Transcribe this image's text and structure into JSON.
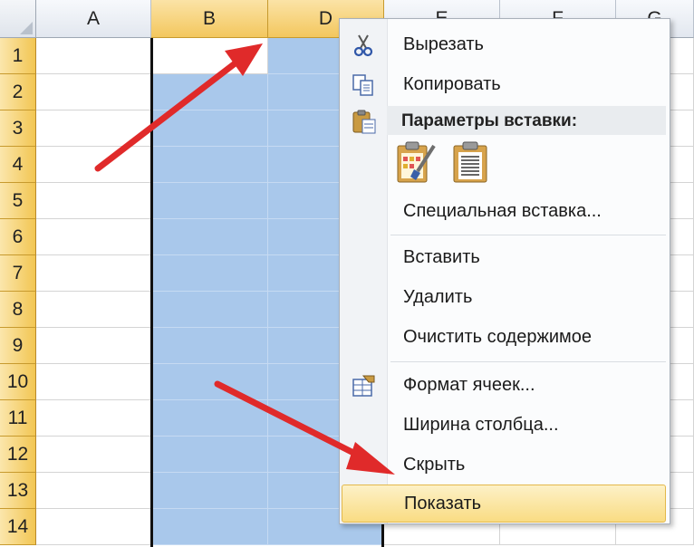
{
  "columns": [
    {
      "label": "A",
      "selected": false
    },
    {
      "label": "B",
      "selected": true
    },
    {
      "label": "D",
      "selected": true
    },
    {
      "label": "E",
      "selected": false
    },
    {
      "label": "F",
      "selected": false
    },
    {
      "label": "G",
      "selected": false
    }
  ],
  "rows": [
    "1",
    "2",
    "3",
    "4",
    "5",
    "6",
    "7",
    "8",
    "9",
    "10",
    "11",
    "12",
    "13",
    "14"
  ],
  "context_menu": {
    "cut": "Вырезать",
    "copy": "Копировать",
    "paste_options_header": "Параметры вставки:",
    "paste_special": "Специальная вставка...",
    "insert": "Вставить",
    "delete": "Удалить",
    "clear_contents": "Очистить содержимое",
    "format_cells": "Формат ячеек...",
    "column_width": "Ширина столбца...",
    "hide": "Скрыть",
    "unhide": "Показать"
  },
  "colors": {
    "selection": "#a9c8eb",
    "header_selected": "#f3c75e",
    "menu_highlight": "#f9dc83",
    "arrow": "#e02a2a"
  }
}
